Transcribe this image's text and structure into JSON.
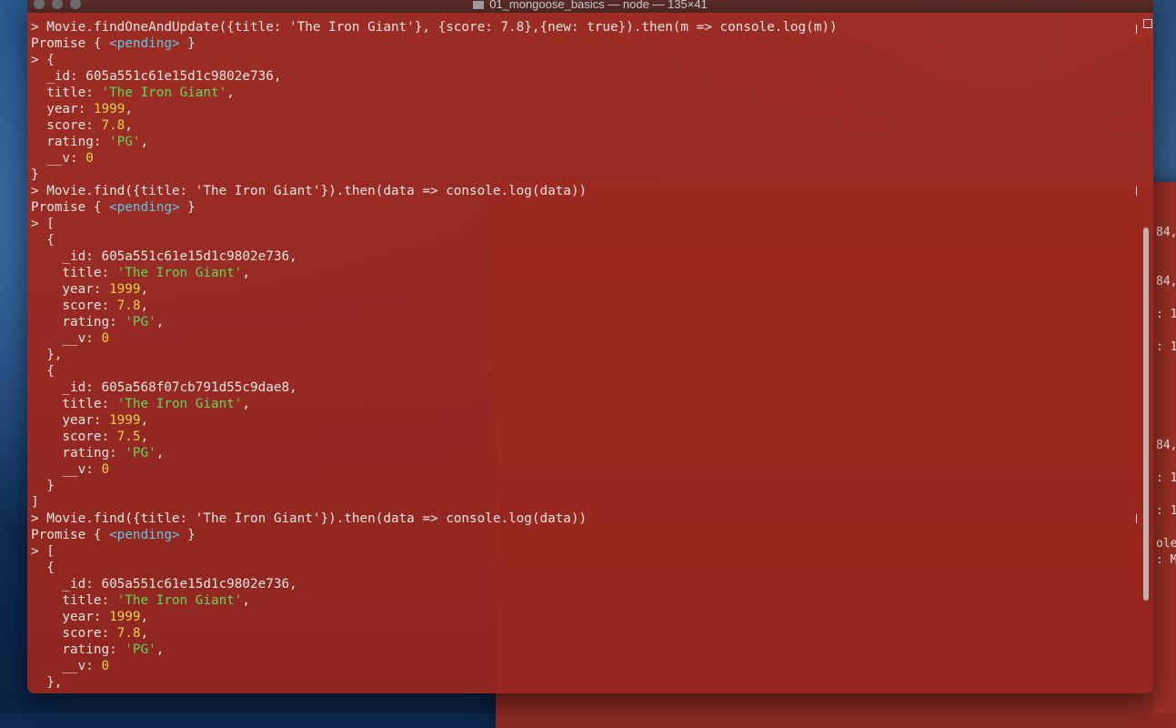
{
  "window": {
    "title": "01_mongoose_basics — node — 135×41"
  },
  "terminal": {
    "lines": [
      [
        {
          "t": "> Movie.findOneAndUpdate({title: 'The Iron Giant'}, {score: 7.8},{new: true}).then(m => console.log(m))",
          "c": ""
        }
      ],
      [
        {
          "t": "Promise { ",
          "c": ""
        },
        {
          "t": "<pending>",
          "c": "pend"
        },
        {
          "t": " }",
          "c": ""
        }
      ],
      [
        {
          "t": "> {",
          "c": ""
        }
      ],
      [
        {
          "t": "  _id: 605a551c61e15d1c9802e736,",
          "c": ""
        }
      ],
      [
        {
          "t": "  title: ",
          "c": ""
        },
        {
          "t": "'The Iron Giant'",
          "c": "str"
        },
        {
          "t": ",",
          "c": ""
        }
      ],
      [
        {
          "t": "  year: ",
          "c": ""
        },
        {
          "t": "1999",
          "c": "num"
        },
        {
          "t": ",",
          "c": ""
        }
      ],
      [
        {
          "t": "  score: ",
          "c": ""
        },
        {
          "t": "7.8",
          "c": "num"
        },
        {
          "t": ",",
          "c": ""
        }
      ],
      [
        {
          "t": "  rating: ",
          "c": ""
        },
        {
          "t": "'PG'",
          "c": "str"
        },
        {
          "t": ",",
          "c": ""
        }
      ],
      [
        {
          "t": "  __v: ",
          "c": ""
        },
        {
          "t": "0",
          "c": "num"
        }
      ],
      [
        {
          "t": "}",
          "c": ""
        }
      ],
      [
        {
          "t": "> Movie.find({title: 'The Iron Giant'}).then(data => console.log(data))",
          "c": ""
        }
      ],
      [
        {
          "t": "Promise { ",
          "c": ""
        },
        {
          "t": "<pending>",
          "c": "pend"
        },
        {
          "t": " }",
          "c": ""
        }
      ],
      [
        {
          "t": "> [",
          "c": ""
        }
      ],
      [
        {
          "t": "  {",
          "c": ""
        }
      ],
      [
        {
          "t": "    _id: 605a551c61e15d1c9802e736,",
          "c": ""
        }
      ],
      [
        {
          "t": "    title: ",
          "c": ""
        },
        {
          "t": "'The Iron Giant'",
          "c": "str"
        },
        {
          "t": ",",
          "c": ""
        }
      ],
      [
        {
          "t": "    year: ",
          "c": ""
        },
        {
          "t": "1999",
          "c": "num"
        },
        {
          "t": ",",
          "c": ""
        }
      ],
      [
        {
          "t": "    score: ",
          "c": ""
        },
        {
          "t": "7.8",
          "c": "num"
        },
        {
          "t": ",",
          "c": ""
        }
      ],
      [
        {
          "t": "    rating: ",
          "c": ""
        },
        {
          "t": "'PG'",
          "c": "str"
        },
        {
          "t": ",",
          "c": ""
        }
      ],
      [
        {
          "t": "    __v: ",
          "c": ""
        },
        {
          "t": "0",
          "c": "num"
        }
      ],
      [
        {
          "t": "  },",
          "c": ""
        }
      ],
      [
        {
          "t": "  {",
          "c": ""
        }
      ],
      [
        {
          "t": "    _id: 605a568f07cb791d55c9dae8,",
          "c": ""
        }
      ],
      [
        {
          "t": "    title: ",
          "c": ""
        },
        {
          "t": "'The Iron Giant'",
          "c": "str"
        },
        {
          "t": ",",
          "c": ""
        }
      ],
      [
        {
          "t": "    year: ",
          "c": ""
        },
        {
          "t": "1999",
          "c": "num"
        },
        {
          "t": ",",
          "c": ""
        }
      ],
      [
        {
          "t": "    score: ",
          "c": ""
        },
        {
          "t": "7.5",
          "c": "num"
        },
        {
          "t": ",",
          "c": ""
        }
      ],
      [
        {
          "t": "    rating: ",
          "c": ""
        },
        {
          "t": "'PG'",
          "c": "str"
        },
        {
          "t": ",",
          "c": ""
        }
      ],
      [
        {
          "t": "    __v: ",
          "c": ""
        },
        {
          "t": "0",
          "c": "num"
        }
      ],
      [
        {
          "t": "  }",
          "c": ""
        }
      ],
      [
        {
          "t": "]",
          "c": ""
        }
      ],
      [
        {
          "t": "> Movie.find({title: 'The Iron Giant'}).then(data => console.log(data))",
          "c": ""
        }
      ],
      [
        {
          "t": "Promise { ",
          "c": ""
        },
        {
          "t": "<pending>",
          "c": "pend"
        },
        {
          "t": " }",
          "c": ""
        }
      ],
      [
        {
          "t": "> [",
          "c": ""
        }
      ],
      [
        {
          "t": "  {",
          "c": ""
        }
      ],
      [
        {
          "t": "    _id: 605a551c61e15d1c9802e736,",
          "c": ""
        }
      ],
      [
        {
          "t": "    title: ",
          "c": ""
        },
        {
          "t": "'The Iron Giant'",
          "c": "str"
        },
        {
          "t": ",",
          "c": ""
        }
      ],
      [
        {
          "t": "    year: ",
          "c": ""
        },
        {
          "t": "1999",
          "c": "num"
        },
        {
          "t": ",",
          "c": ""
        }
      ],
      [
        {
          "t": "    score: ",
          "c": ""
        },
        {
          "t": "7.8",
          "c": "num"
        },
        {
          "t": ",",
          "c": ""
        }
      ],
      [
        {
          "t": "    rating: ",
          "c": ""
        },
        {
          "t": "'PG'",
          "c": "str"
        },
        {
          "t": ",",
          "c": ""
        }
      ],
      [
        {
          "t": "    __v: ",
          "c": ""
        },
        {
          "t": "0",
          "c": "num"
        }
      ],
      [
        {
          "t": "  },",
          "c": ""
        }
      ]
    ]
  },
  "background_window": {
    "snippets": [
      "84,",
      "84,",
      ": 1",
      ": 1",
      "84,",
      ": 1",
      ": 1",
      "ole",
      ": M"
    ]
  },
  "colors": {
    "terminal_bg": "#99281f",
    "string": "#5fd85a",
    "number": "#e6d34a",
    "pending": "#5fc6e8",
    "text": "#ece4e2"
  }
}
